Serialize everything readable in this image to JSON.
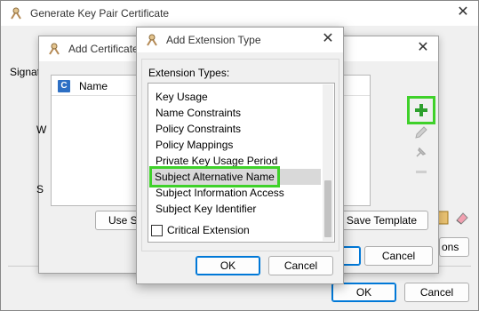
{
  "main": {
    "title": "Generate Key Pair Certificate",
    "sign_label": "Signat",
    "left_letter_w": "W",
    "left_letter_s": "S",
    "options_button": "ons",
    "ok_button": "OK",
    "cancel_button": "Cancel"
  },
  "addcert": {
    "title": "Add Certificate",
    "table_header": "Name",
    "use_template_button": "Use St",
    "save_template_button": "Save Template",
    "ok_button": "OK",
    "cancel_button": "Cancel"
  },
  "ext": {
    "title": "Add Extension Type",
    "types_label": "Extension Types:",
    "items": [
      "Key Usage",
      "Name Constraints",
      "Policy Constraints",
      "Policy Mappings",
      "Private Key Usage Period",
      "Subject Alternative Name",
      "Subject Information Access",
      "Subject Key Identifier"
    ],
    "selected_index": 5,
    "critical_label": "Critical Extension",
    "critical_checked": false,
    "ok_button": "OK",
    "cancel_button": "Cancel"
  },
  "icons": {
    "app": "key-certificate-icon",
    "add": "plus-icon",
    "edit": "pencil-icon",
    "pin": "pin-icon",
    "remove": "minus-icon",
    "eraser": "eraser-icon",
    "template": "template-icon"
  },
  "colors": {
    "highlight": "#3fd12a",
    "accent": "#0078d7",
    "selection": "#d9d9d9"
  }
}
